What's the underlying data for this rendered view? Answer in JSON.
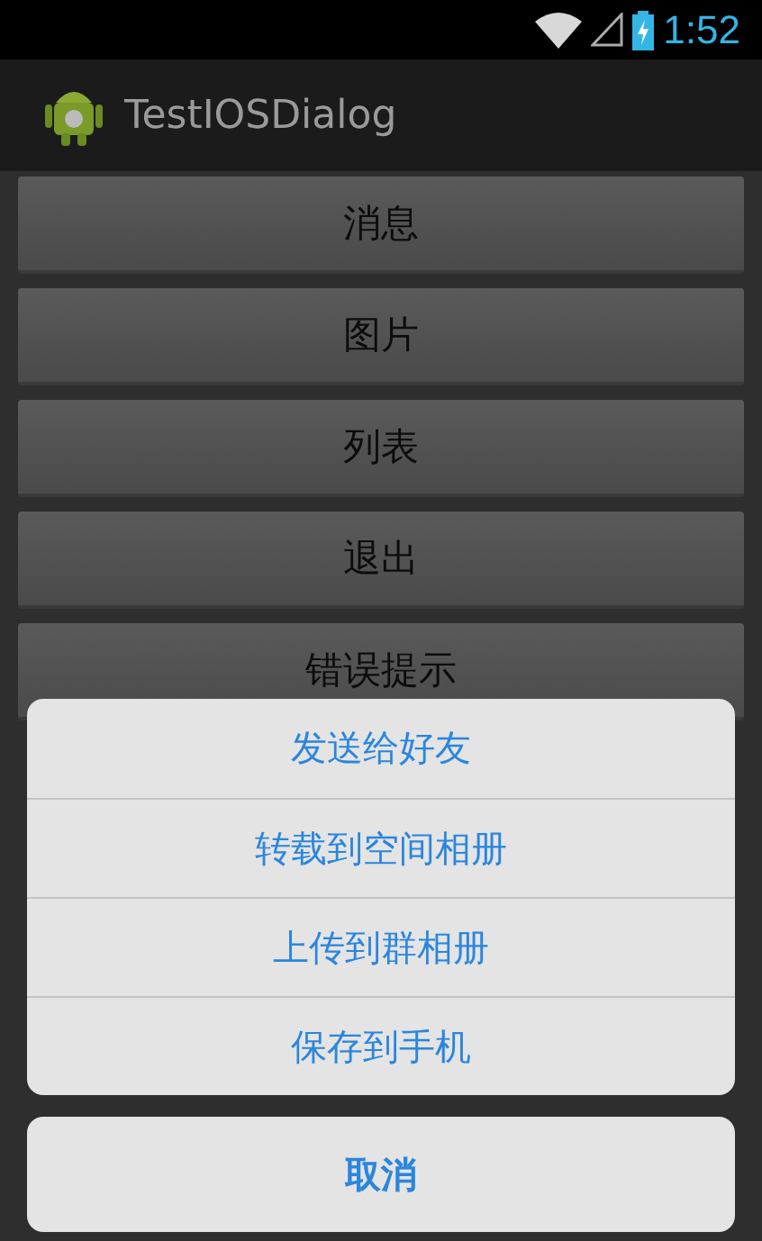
{
  "status_bar": {
    "time": "1:52"
  },
  "app_bar": {
    "title": "TestIOSDialog"
  },
  "buttons": [
    {
      "label": "消息"
    },
    {
      "label": "图片"
    },
    {
      "label": "列表"
    },
    {
      "label": "退出"
    },
    {
      "label": "错误提示"
    }
  ],
  "action_sheet": {
    "items": [
      {
        "label": "发送给好友"
      },
      {
        "label": "转载到空间相册"
      },
      {
        "label": "上传到群相册"
      },
      {
        "label": "保存到手机"
      }
    ],
    "cancel": "取消"
  }
}
